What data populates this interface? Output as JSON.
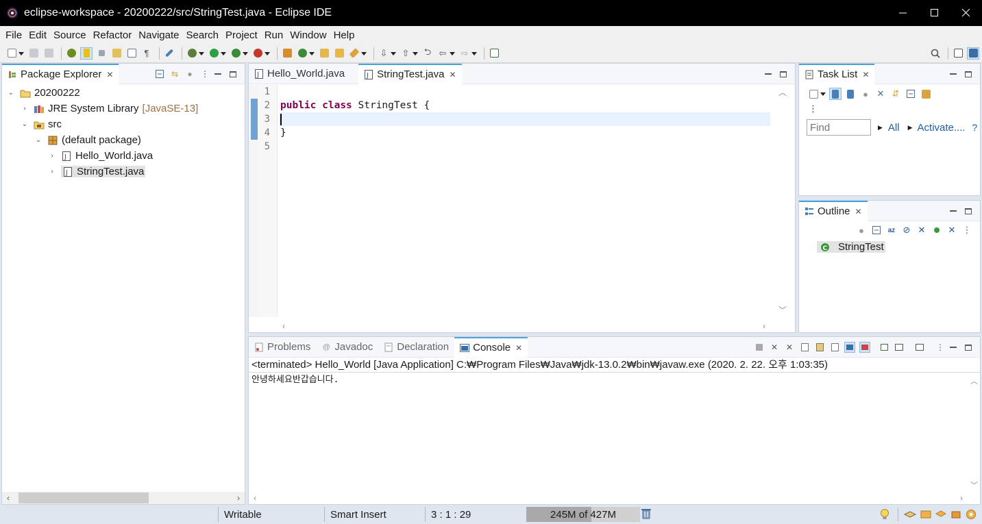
{
  "window": {
    "title": "eclipse-workspace - 20200222/src/StringTest.java - Eclipse IDE",
    "minimize": "—",
    "maximize": "☐",
    "close": "✕"
  },
  "menu": [
    "File",
    "Edit",
    "Source",
    "Refactor",
    "Navigate",
    "Search",
    "Project",
    "Run",
    "Window",
    "Help"
  ],
  "package_explorer": {
    "tab_label": "Package Explorer",
    "tree": [
      {
        "label": "20200222",
        "level": 0,
        "expanded": true,
        "icon": "project-icon"
      },
      {
        "label": "JRE System Library",
        "decoration": "[JavaSE-13]",
        "level": 1,
        "expanded": false,
        "icon": "library-icon"
      },
      {
        "label": "src",
        "level": 1,
        "expanded": true,
        "icon": "source-folder-icon"
      },
      {
        "label": "(default package)",
        "level": 2,
        "expanded": true,
        "icon": "package-icon"
      },
      {
        "label": "Hello_World.java",
        "level": 3,
        "expanded": false,
        "icon": "java-file-icon"
      },
      {
        "label": "StringTest.java",
        "level": 3,
        "expanded": false,
        "icon": "java-file-icon",
        "selected": true
      }
    ]
  },
  "editor": {
    "tabs": [
      {
        "label": "Hello_World.java",
        "active": false
      },
      {
        "label": "StringTest.java",
        "active": true
      }
    ],
    "line_numbers": [
      "1",
      "2",
      "3",
      "4",
      "5"
    ],
    "code": {
      "line1": "",
      "line2_kw1": "public",
      "line2_kw2": "class",
      "line2_rest": " StringTest {",
      "line3": "",
      "line4": "}",
      "line5": ""
    }
  },
  "task_list": {
    "tab_label": "Task List",
    "find_placeholder": "Find",
    "all_label": "All",
    "activate_label": "Activate....",
    "help": "?"
  },
  "outline": {
    "tab_label": "Outline",
    "items": [
      {
        "label": "StringTest",
        "icon": "class-icon"
      }
    ]
  },
  "bottom": {
    "tabs": [
      {
        "label": "Problems",
        "active": false
      },
      {
        "label": "Javadoc",
        "active": false
      },
      {
        "label": "Declaration",
        "active": false
      },
      {
        "label": "Console",
        "active": true
      }
    ],
    "console_header": "<terminated> Hello_World [Java Application] C:₩Program Files₩Java₩jdk-13.0.2₩bin₩javaw.exe (2020. 2. 22. 오후 1:03:35)",
    "console_output": "안녕하세요반갑습니다."
  },
  "status": {
    "writable": "Writable",
    "insert_mode": "Smart Insert",
    "position": "3 : 1 : 29",
    "heap_used": "245M",
    "heap_of": "of",
    "heap_total": "427M",
    "heap_fraction": 0.57
  },
  "colors": {
    "keyword": "#7f0055",
    "active_tab_border": "#4da3d9",
    "current_line": "#e8f2fe",
    "chrome": "#dfe6ef"
  }
}
